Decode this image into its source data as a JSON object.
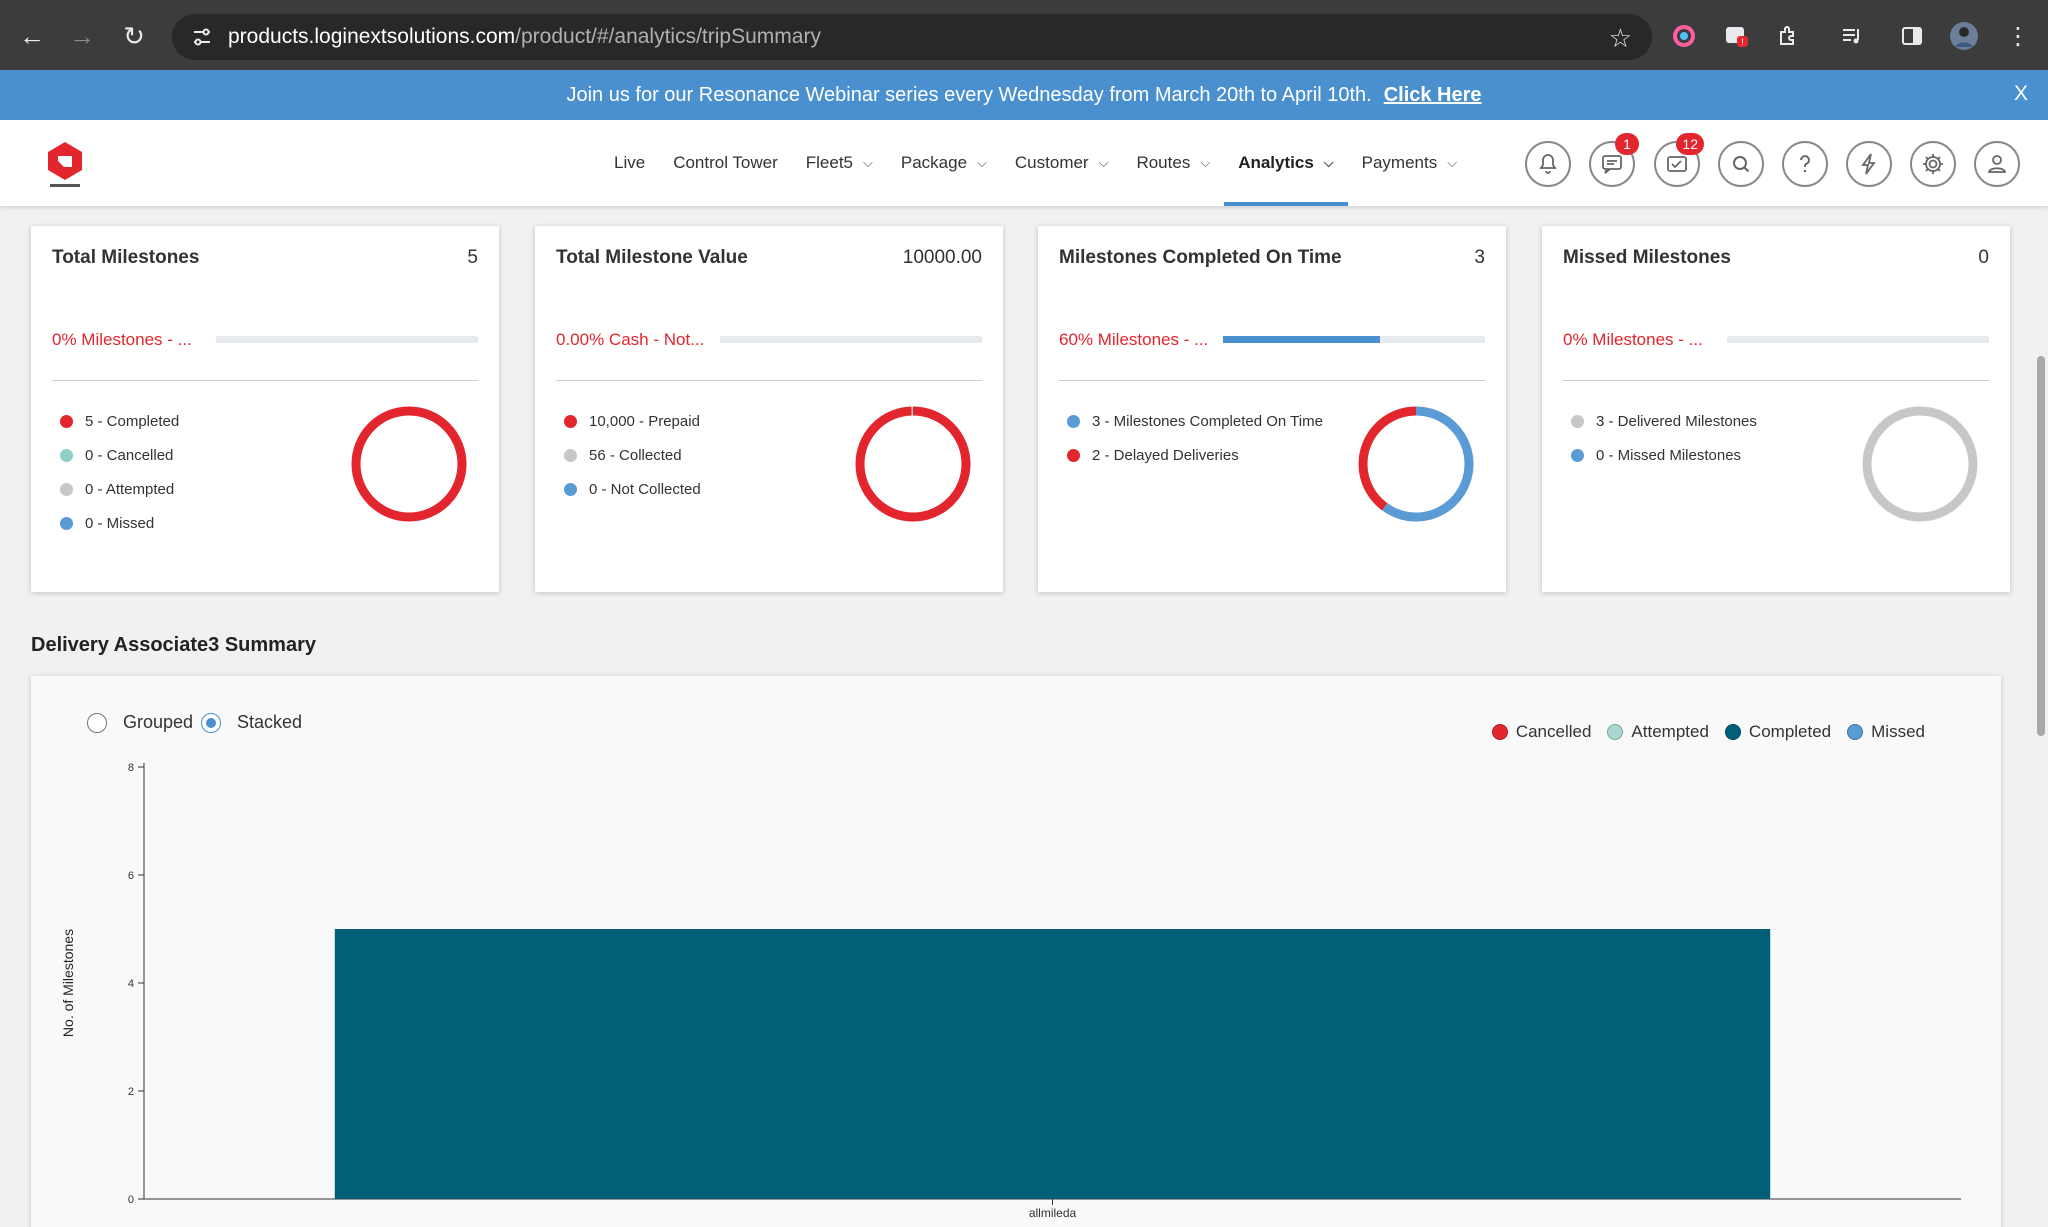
{
  "browser": {
    "url_host": "products.loginextsolutions.com",
    "url_path": "/product/#/analytics/tripSummary"
  },
  "banner": {
    "text": "Join us for our Resonance Webinar series every Wednesday from March 20th to April 10th.",
    "link": "Click Here",
    "close": "X"
  },
  "nav": {
    "items": [
      {
        "label": "Live",
        "dropdown": false
      },
      {
        "label": "Control Tower",
        "dropdown": false
      },
      {
        "label": "Fleet5",
        "dropdown": true
      },
      {
        "label": "Package",
        "dropdown": true
      },
      {
        "label": "Customer",
        "dropdown": true
      },
      {
        "label": "Routes",
        "dropdown": true
      },
      {
        "label": "Analytics",
        "dropdown": true,
        "active": true
      },
      {
        "label": "Payments",
        "dropdown": true
      }
    ],
    "icons": [
      {
        "name": "notifications-bell-icon",
        "badge": ""
      },
      {
        "name": "messages-icon",
        "badge": "1"
      },
      {
        "name": "mail-icon",
        "badge": "12"
      },
      {
        "name": "search-icon",
        "badge": ""
      },
      {
        "name": "help-icon",
        "badge": ""
      },
      {
        "name": "lightning-icon",
        "badge": ""
      },
      {
        "name": "settings-gear-icon",
        "badge": ""
      },
      {
        "name": "user-profile-icon",
        "badge": ""
      }
    ]
  },
  "cards": [
    {
      "title": "Total Milestones",
      "value": "5",
      "pct_text": "0% Milestones - ...",
      "bar_fill": 0,
      "legend": [
        {
          "label": "5 - Completed",
          "color": "#e3262e"
        },
        {
          "label": "0 - Cancelled",
          "color": "#8ecfc9"
        },
        {
          "label": "0 - Attempted",
          "color": "#c8c6c6"
        },
        {
          "label": "0 - Missed",
          "color": "#5b9bd5"
        }
      ],
      "donut": [
        {
          "value": 5,
          "color": "#e3262e"
        }
      ]
    },
    {
      "title": "Total Milestone Value",
      "value": "10000.00",
      "pct_text": "0.00% Cash - Not...",
      "bar_fill": 0,
      "legend": [
        {
          "label": "10,000 - Prepaid",
          "color": "#e3262e"
        },
        {
          "label": "56 - Collected",
          "color": "#c8c6c6"
        },
        {
          "label": "0 - Not Collected",
          "color": "#5b9bd5"
        }
      ],
      "donut": [
        {
          "value": 10000,
          "color": "#e3262e"
        },
        {
          "value": 56,
          "color": "#c8c6c6"
        }
      ]
    },
    {
      "title": "Milestones Completed On Time",
      "value": "3",
      "pct_text": "60% Milestones - ...",
      "bar_fill": 0.6,
      "legend": [
        {
          "label": "3 - Milestones Completed On Time",
          "color": "#5b9bd5"
        },
        {
          "label": "2 - Delayed Deliveries",
          "color": "#e3262e"
        }
      ],
      "donut": [
        {
          "value": 3,
          "color": "#5b9bd5"
        },
        {
          "value": 2,
          "color": "#e3262e"
        }
      ]
    },
    {
      "title": "Missed Milestones",
      "value": "0",
      "pct_text": "0% Milestones - ...",
      "bar_fill": 0,
      "legend": [
        {
          "label": "3 - Delivered Milestones",
          "color": "#c8c6c6"
        },
        {
          "label": "0 - Missed Milestones",
          "color": "#5b9bd5"
        }
      ],
      "donut": [
        {
          "value": 3,
          "color": "#c8c6c6"
        }
      ]
    }
  ],
  "section_title": "Delivery Associate3 Summary",
  "chart_controls": {
    "grouped": "Grouped",
    "stacked": "Stacked",
    "selected": "Stacked"
  },
  "chart_legend": [
    {
      "label": "Cancelled",
      "color": "#e3262e"
    },
    {
      "label": "Attempted",
      "color": "#a9d7d2"
    },
    {
      "label": "Completed",
      "color": "#025f78"
    },
    {
      "label": "Missed",
      "color": "#5b9bd5"
    }
  ],
  "chart_data": {
    "type": "bar",
    "stacked": true,
    "categories": [
      "allmileda"
    ],
    "series": [
      {
        "name": "Cancelled",
        "values": [
          0
        ],
        "color": "#e3262e"
      },
      {
        "name": "Attempted",
        "values": [
          0
        ],
        "color": "#a9d7d2"
      },
      {
        "name": "Completed",
        "values": [
          5
        ],
        "color": "#025f78"
      },
      {
        "name": "Missed",
        "values": [
          0
        ],
        "color": "#5b9bd5"
      }
    ],
    "ylabel": "No. of Milestones",
    "ylim": [
      0,
      8
    ],
    "yticks": [
      0,
      2,
      4,
      6,
      8
    ],
    "grid": false
  }
}
